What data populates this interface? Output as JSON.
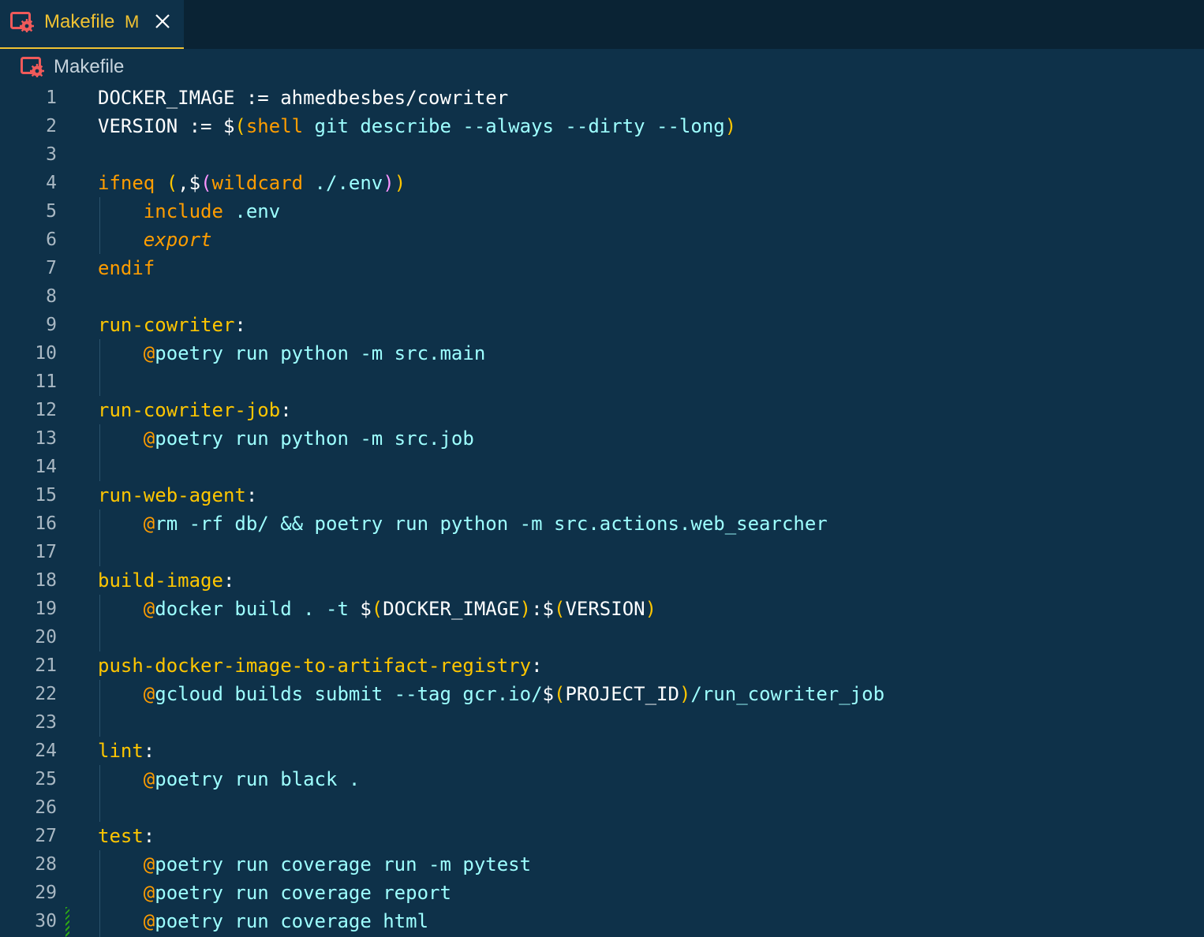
{
  "tab": {
    "title": "Makefile",
    "status": "M",
    "icon": "makefile-gear-icon",
    "close_icon": "close-icon"
  },
  "breadcrumb": {
    "label": "Makefile",
    "icon": "makefile-gear-icon"
  },
  "colors": {
    "background": "#0e3149",
    "tabbar": "#0a2334",
    "accent": "#f1c232",
    "keyword": "#ff9d00",
    "target": "#ffc600",
    "string": "#9effff",
    "paren_inner": "#fb94ff",
    "plain": "#ffffff"
  },
  "code": {
    "line_numbers": [
      "1",
      "2",
      "3",
      "4",
      "5",
      "6",
      "7",
      "8",
      "9",
      "10",
      "11",
      "12",
      "13",
      "14",
      "15",
      "16",
      "17",
      "18",
      "19",
      "20",
      "21",
      "22",
      "23",
      "24",
      "25",
      "26",
      "27",
      "28",
      "29",
      "30"
    ],
    "lines": [
      [
        [
          "w",
          "DOCKER_IMAGE := ahmedbesbes/cowriter"
        ]
      ],
      [
        [
          "w",
          "VERSION := $"
        ],
        [
          "y",
          "("
        ],
        [
          "o",
          "shell"
        ],
        [
          "c",
          " git describe --always --dirty --long"
        ],
        [
          "y",
          ")"
        ]
      ],
      [],
      [
        [
          "o",
          "ifneq "
        ],
        [
          "y",
          "("
        ],
        [
          "w",
          ",$"
        ],
        [
          "p",
          "("
        ],
        [
          "o",
          "wildcard"
        ],
        [
          "c",
          " ./.env"
        ],
        [
          "p",
          ")"
        ],
        [
          "y",
          ")"
        ]
      ],
      [
        [
          "w",
          "    "
        ],
        [
          "o",
          "include"
        ],
        [
          "c",
          " .env"
        ]
      ],
      [
        [
          "w",
          "    "
        ],
        [
          "oi",
          "export"
        ]
      ],
      [
        [
          "o",
          "endif"
        ]
      ],
      [],
      [
        [
          "y",
          "run-cowriter"
        ],
        [
          "w",
          ":"
        ]
      ],
      [
        [
          "w",
          "    "
        ],
        [
          "o",
          "@"
        ],
        [
          "c",
          "poetry run python -m src.main"
        ]
      ],
      [],
      [
        [
          "y",
          "run-cowriter-job"
        ],
        [
          "w",
          ":"
        ]
      ],
      [
        [
          "w",
          "    "
        ],
        [
          "o",
          "@"
        ],
        [
          "c",
          "poetry run python -m src.job"
        ]
      ],
      [],
      [
        [
          "y",
          "run-web-agent"
        ],
        [
          "w",
          ":"
        ]
      ],
      [
        [
          "w",
          "    "
        ],
        [
          "o",
          "@"
        ],
        [
          "c",
          "rm -rf db/ && poetry run python -m src.actions.web_searcher"
        ]
      ],
      [],
      [
        [
          "y",
          "build-image"
        ],
        [
          "w",
          ":"
        ]
      ],
      [
        [
          "w",
          "    "
        ],
        [
          "o",
          "@"
        ],
        [
          "c",
          "docker build . -t "
        ],
        [
          "w",
          "$"
        ],
        [
          "y",
          "("
        ],
        [
          "w",
          "DOCKER_IMAGE"
        ],
        [
          "y",
          ")"
        ],
        [
          "w",
          ":$"
        ],
        [
          "y",
          "("
        ],
        [
          "w",
          "VERSION"
        ],
        [
          "y",
          ")"
        ]
      ],
      [],
      [
        [
          "y",
          "push-docker-image-to-artifact-registry"
        ],
        [
          "w",
          ":"
        ]
      ],
      [
        [
          "w",
          "    "
        ],
        [
          "o",
          "@"
        ],
        [
          "c",
          "gcloud builds submit --tag gcr.io/"
        ],
        [
          "w",
          "$"
        ],
        [
          "y",
          "("
        ],
        [
          "w",
          "PROJECT_ID"
        ],
        [
          "y",
          ")"
        ],
        [
          "c",
          "/run_cowriter_job"
        ]
      ],
      [],
      [
        [
          "y",
          "lint"
        ],
        [
          "w",
          ":"
        ]
      ],
      [
        [
          "w",
          "    "
        ],
        [
          "o",
          "@"
        ],
        [
          "c",
          "poetry run black ."
        ]
      ],
      [],
      [
        [
          "y",
          "test"
        ],
        [
          "w",
          ":"
        ]
      ],
      [
        [
          "w",
          "    "
        ],
        [
          "o",
          "@"
        ],
        [
          "c",
          "poetry run coverage run -m pytest"
        ]
      ],
      [
        [
          "w",
          "    "
        ],
        [
          "o",
          "@"
        ],
        [
          "c",
          "poetry run coverage report"
        ]
      ],
      [
        [
          "w",
          "    "
        ],
        [
          "o",
          "@"
        ],
        [
          "c",
          "poetry run coverage html"
        ]
      ]
    ]
  }
}
